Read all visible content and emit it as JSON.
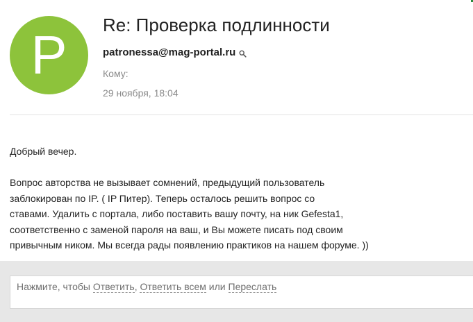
{
  "message": {
    "avatar_letter": "P",
    "avatar_color": "#8dc33b",
    "subject": "Re: Проверка подлинности",
    "sender": "patronessa@mag-portal.ru",
    "to_label": "Кому:",
    "date": "29 ноября, 18:04"
  },
  "body": {
    "greeting": "Добрый вечер.",
    "lines": [
      "Вопрос авторства не вызывает сомнений, предыдущий пользователь",
      "заблокирован по IP. ( IP Питер). Теперь осталось решить вопрос со",
      "ставами. Удалить с портала, либо поставить вашу почту, на ник Gefesta1,",
      "соответственно с заменой пароля на ваш, и Вы можете писать под своим",
      "привычным ником. Мы всегда рады появлению практиков на нашем форуме. ))"
    ]
  },
  "reply": {
    "prefix": "Нажмите, чтобы ",
    "reply_label": "Ответить",
    "sep1": ", ",
    "reply_all_label": "Ответить всем",
    "sep2": " или ",
    "forward_label": "Переслать"
  },
  "icons": {
    "sender_search": "search-icon"
  }
}
